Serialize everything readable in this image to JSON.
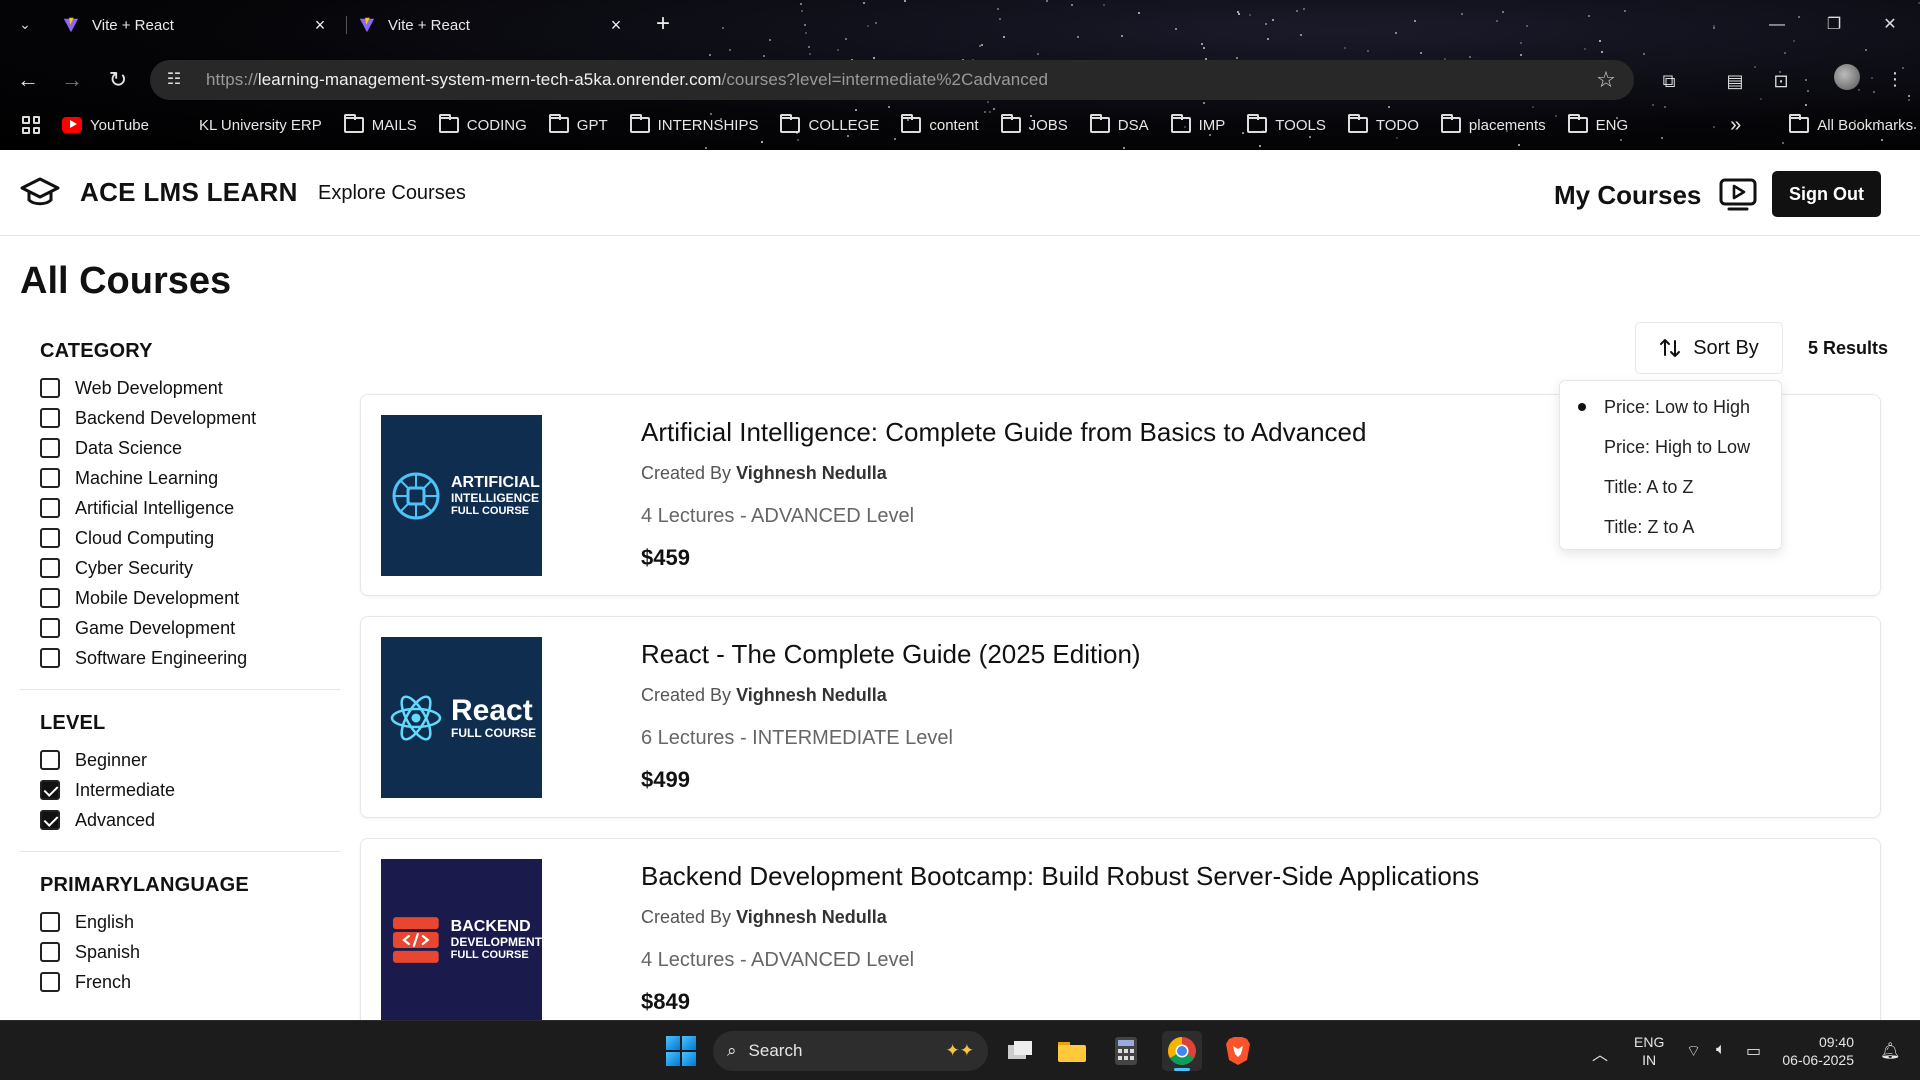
{
  "browser": {
    "tabs": [
      {
        "title": "Vite + React"
      },
      {
        "title": "Vite + React"
      }
    ],
    "url": {
      "scheme": "https://",
      "host": "learning-management-system-mern-tech-a5ka.onrender.com",
      "path": "/courses?level=intermediate%2Cadvanced"
    },
    "bookmarks": [
      {
        "label": "YouTube",
        "icon": "youtube-icon"
      },
      {
        "label": "KL University ERP",
        "icon": "microsoft-icon"
      },
      {
        "label": "MAILS",
        "icon": "folder-icon"
      },
      {
        "label": "CODING",
        "icon": "folder-icon"
      },
      {
        "label": "GPT",
        "icon": "folder-icon"
      },
      {
        "label": "INTERNSHIPS",
        "icon": "folder-icon"
      },
      {
        "label": "COLLEGE",
        "icon": "folder-icon"
      },
      {
        "label": "content",
        "icon": "folder-icon"
      },
      {
        "label": "JOBS",
        "icon": "folder-icon"
      },
      {
        "label": "DSA",
        "icon": "folder-icon"
      },
      {
        "label": "IMP",
        "icon": "folder-icon"
      },
      {
        "label": "TOOLS",
        "icon": "folder-icon"
      },
      {
        "label": "TODO",
        "icon": "folder-icon"
      },
      {
        "label": "placements",
        "icon": "folder-icon"
      },
      {
        "label": "ENG",
        "icon": "folder-icon"
      }
    ],
    "overflow": "»",
    "all_bookmarks": "All Bookmarks"
  },
  "header": {
    "brand": "ACE LMS LEARN",
    "explore": "Explore Courses",
    "my_courses": "My Courses",
    "sign_out": "Sign Out"
  },
  "page": {
    "title": "All Courses",
    "sort_label": "Sort By",
    "results": "5 Results"
  },
  "filters": {
    "category": {
      "heading": "CATEGORY",
      "options": [
        {
          "label": "Web Development",
          "checked": false
        },
        {
          "label": "Backend Development",
          "checked": false
        },
        {
          "label": "Data Science",
          "checked": false
        },
        {
          "label": "Machine Learning",
          "checked": false
        },
        {
          "label": "Artificial Intelligence",
          "checked": false
        },
        {
          "label": "Cloud Computing",
          "checked": false
        },
        {
          "label": "Cyber Security",
          "checked": false
        },
        {
          "label": "Mobile Development",
          "checked": false
        },
        {
          "label": "Game Development",
          "checked": false
        },
        {
          "label": "Software Engineering",
          "checked": false
        }
      ]
    },
    "level": {
      "heading": "LEVEL",
      "options": [
        {
          "label": "Beginner",
          "checked": false
        },
        {
          "label": "Intermediate",
          "checked": true
        },
        {
          "label": "Advanced",
          "checked": true
        }
      ]
    },
    "language": {
      "heading": "PRIMARYLANGUAGE",
      "options": [
        {
          "label": "English",
          "checked": false
        },
        {
          "label": "Spanish",
          "checked": false
        },
        {
          "label": "French",
          "checked": false
        }
      ]
    }
  },
  "sort_menu": {
    "options": [
      {
        "label": "Price: Low to High",
        "selected": true
      },
      {
        "label": "Price: High to Low",
        "selected": false
      },
      {
        "label": "Title: A to Z",
        "selected": false
      },
      {
        "label": "Title: Z to A",
        "selected": false
      }
    ]
  },
  "courses": [
    {
      "title": "Artificial Intelligence: Complete Guide from Basics to Advanced",
      "created_prefix": "Created By",
      "author": "Vighnesh Nedulla",
      "meta": "4 Lectures - ADVANCED Level",
      "price": "$459",
      "thumb": {
        "line1": "ARTIFICIAL",
        "line2": "INTELLIGENCE",
        "line3": "FULL COURSE",
        "bg": "#0f2d4f",
        "icon": "brain-chip-icon"
      }
    },
    {
      "title": "React - The Complete Guide (2025 Edition)",
      "created_prefix": "Created By",
      "author": "Vighnesh Nedulla",
      "meta": "6 Lectures - INTERMEDIATE Level",
      "price": "$499",
      "thumb": {
        "line1": "React",
        "line2": "FULL COURSE",
        "line3": "",
        "bg": "#0f2d4f",
        "icon": "react-atom-icon"
      }
    },
    {
      "title": "Backend Development Bootcamp: Build Robust Server-Side Applications",
      "created_prefix": "Created By",
      "author": "Vighnesh Nedulla",
      "meta": "4 Lectures - ADVANCED Level",
      "price": "$849",
      "thumb": {
        "line1": "BACKEND",
        "line2": "DEVELOPMENT",
        "line3": "FULL COURSE",
        "bg": "#1a1a4d",
        "icon": "server-code-icon"
      }
    }
  ],
  "taskbar": {
    "search": "Search",
    "lang1": "ENG",
    "lang2": "IN",
    "time": "09:40",
    "date": "06-06-2025"
  },
  "colors": {
    "accent_dark": "#111111",
    "thumb_navy": "#0f2d4f",
    "thumb_indigo": "#1a1a4d",
    "backend_orange": "#e8472f",
    "react_cyan": "#61dafb"
  }
}
